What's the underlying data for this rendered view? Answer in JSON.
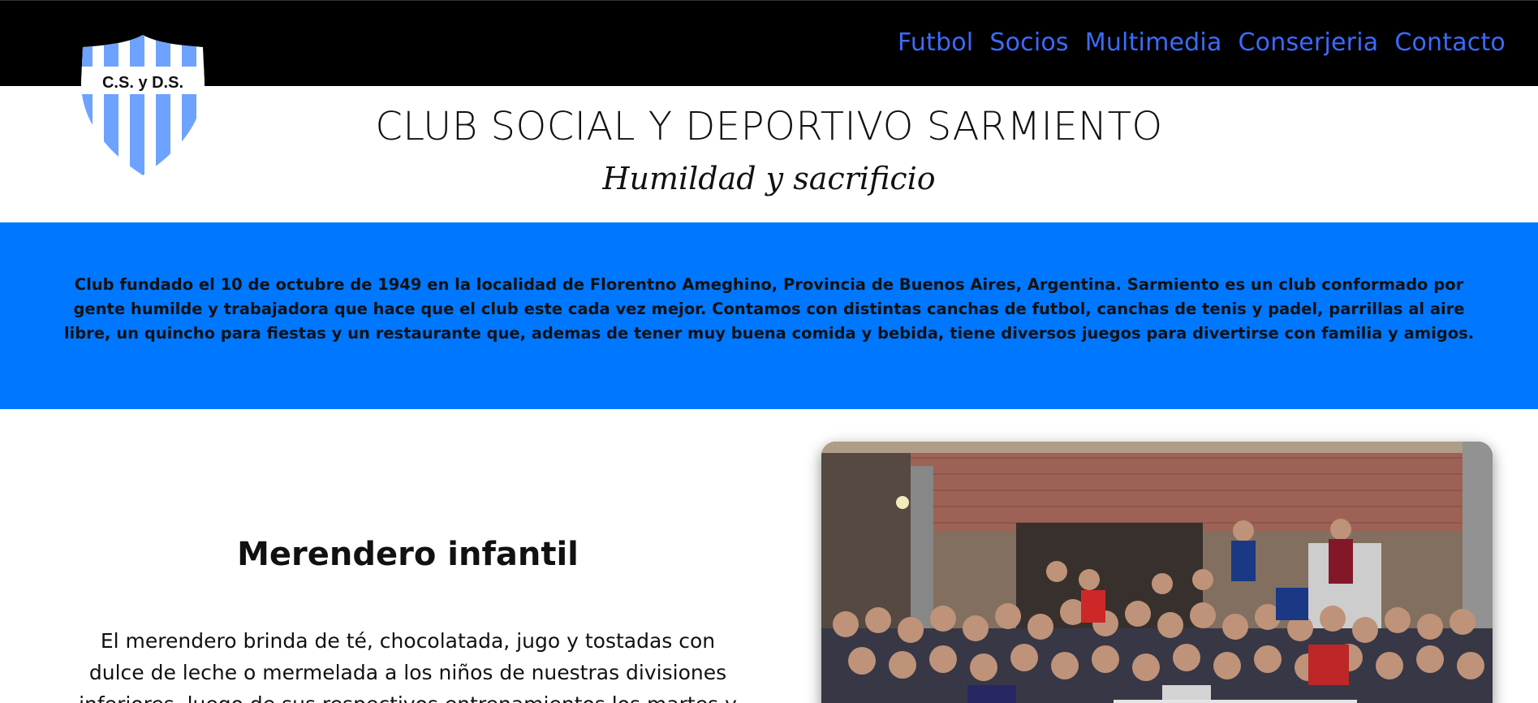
{
  "header": {
    "nav": [
      {
        "label": "Futbol"
      },
      {
        "label": "Socios"
      },
      {
        "label": "Multimedia"
      },
      {
        "label": "Conserjeria"
      },
      {
        "label": "Contacto"
      }
    ],
    "logo_text": "C.S. y D.S."
  },
  "hero": {
    "title": "CLUB SOCIAL Y DEPORTIVO SARMIENTO",
    "subtitle": "Humildad y sacrificio"
  },
  "about": {
    "text": "Club fundado el 10 de octubre de 1949 en la localidad de Florentno Ameghino, Provincia de Buenos Aires, Argentina. Sarmiento es un club conformado por gente humilde y trabajadora que hace que el club este cada vez mejor. Contamos con distintas canchas de futbol, canchas de tenis y padel, parrillas al aire libre, un quincho para fiestas y un restaurante que, ademas de tener muy buena comida y bebida, tiene diversos juegos para divertirse con familia y amigos."
  },
  "merendero": {
    "title": "Merendero infantil",
    "text": "El merendero brinda de té, chocolatada, jugo y tostadas con dulce de leche o mermelada a los niños de nuestras divisiones inferiores, luego de sus respectivos entrenamientos los martes y"
  },
  "colors": {
    "topbar": "#000000",
    "nav_link": "#3b6bff",
    "band": "#0077ff",
    "shield_stripe": "#6ea2ff"
  }
}
